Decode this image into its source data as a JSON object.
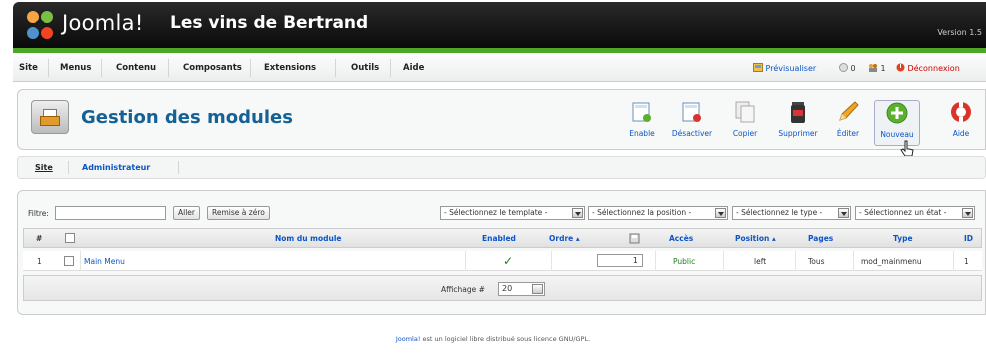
{
  "header": {
    "brand": "Joomla!",
    "site_title": "Les vins de Bertrand",
    "version": "Version 1.5"
  },
  "menubar": {
    "items": [
      "Site",
      "Menus",
      "Contenu",
      "Composants",
      "Extensions",
      "Outils",
      "Aide"
    ],
    "preview": "Prévisualiser",
    "messages_count": "0",
    "users_count": "1",
    "logout": "Déconnexion"
  },
  "toolbar": {
    "heading": "Gestion des modules",
    "buttons": {
      "enable": "Enable",
      "disable": "Désactiver",
      "copy": "Copier",
      "delete": "Supprimer",
      "edit": "Éditer",
      "new": "Nouveau",
      "help": "Aide"
    }
  },
  "submenu": {
    "site": "Site",
    "admin": "Administrateur"
  },
  "filters": {
    "label": "Filtre:",
    "value": "",
    "go": "Aller",
    "reset": "Remise à zéro",
    "template": "- Sélectionnez le template -",
    "position": "- Sélectionnez la position -",
    "type": "- Sélectionnez le type -",
    "state": "- Sélectionnez un état -"
  },
  "table": {
    "headers": {
      "num": "#",
      "name": "Nom du module",
      "enabled": "Enabled",
      "order": "Ordre",
      "access": "Accès",
      "position": "Position",
      "pages": "Pages",
      "type": "Type",
      "id": "ID"
    },
    "rows": [
      {
        "num": "1",
        "name": "Main Menu",
        "enabled": "✓",
        "order": "1",
        "access": "Public",
        "position": "left",
        "pages": "Tous",
        "type": "mod_mainmenu",
        "id": "1"
      }
    ],
    "display_label": "Affichage #",
    "display_value": "20"
  },
  "footer": {
    "link": "Joomla!",
    "text": "est un logiciel libre distribué sous licence GNU/GPL."
  },
  "colors": {
    "header_bg": "#111111",
    "accent_green": "#4fa526",
    "link_blue": "#0b55c4",
    "heading_blue": "#146295"
  }
}
